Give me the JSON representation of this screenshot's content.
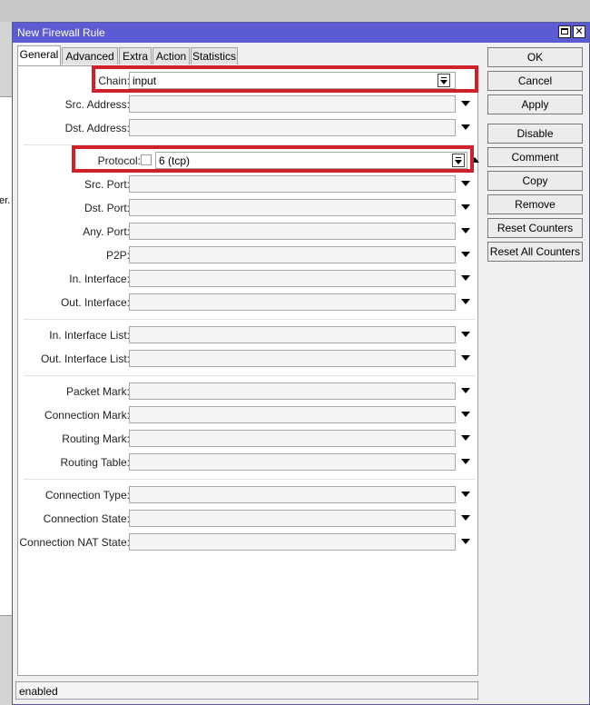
{
  "window": {
    "title": "New Firewall Rule"
  },
  "background": {
    "edge_text": "er."
  },
  "tabs": [
    {
      "label": "General",
      "active": true
    },
    {
      "label": "Advanced",
      "active": false
    },
    {
      "label": "Extra",
      "active": false
    },
    {
      "label": "Action",
      "active": false
    },
    {
      "label": "Statistics",
      "active": false
    }
  ],
  "form": {
    "chain": {
      "label": "Chain:",
      "value": "input"
    },
    "src_address": {
      "label": "Src. Address:",
      "value": ""
    },
    "dst_address": {
      "label": "Dst. Address:",
      "value": ""
    },
    "protocol": {
      "label": "Protocol:",
      "value": "6 (tcp)",
      "negate": false
    },
    "src_port": {
      "label": "Src. Port:",
      "value": ""
    },
    "dst_port": {
      "label": "Dst. Port:",
      "value": ""
    },
    "any_port": {
      "label": "Any. Port:",
      "value": ""
    },
    "p2p": {
      "label": "P2P:",
      "value": ""
    },
    "in_interface": {
      "label": "In. Interface:",
      "value": ""
    },
    "out_interface": {
      "label": "Out. Interface:",
      "value": ""
    },
    "in_interface_list": {
      "label": "In. Interface List:",
      "value": ""
    },
    "out_interface_list": {
      "label": "Out. Interface List:",
      "value": ""
    },
    "packet_mark": {
      "label": "Packet Mark:",
      "value": ""
    },
    "connection_mark": {
      "label": "Connection Mark:",
      "value": ""
    },
    "routing_mark": {
      "label": "Routing Mark:",
      "value": ""
    },
    "routing_table": {
      "label": "Routing Table:",
      "value": ""
    },
    "connection_type": {
      "label": "Connection Type:",
      "value": ""
    },
    "connection_state": {
      "label": "Connection State:",
      "value": ""
    },
    "connection_nat_state": {
      "label": "Connection NAT State:",
      "value": ""
    }
  },
  "buttons": {
    "ok": "OK",
    "cancel": "Cancel",
    "apply": "Apply",
    "disable": "Disable",
    "comment": "Comment",
    "copy": "Copy",
    "remove": "Remove",
    "reset_counters": "Reset Counters",
    "reset_all_counters": "Reset All Counters"
  },
  "status": "enabled",
  "colors": {
    "titlebar": "#5b5bd3",
    "highlight": "#d0202a",
    "link_label": "#1b2a9c"
  }
}
